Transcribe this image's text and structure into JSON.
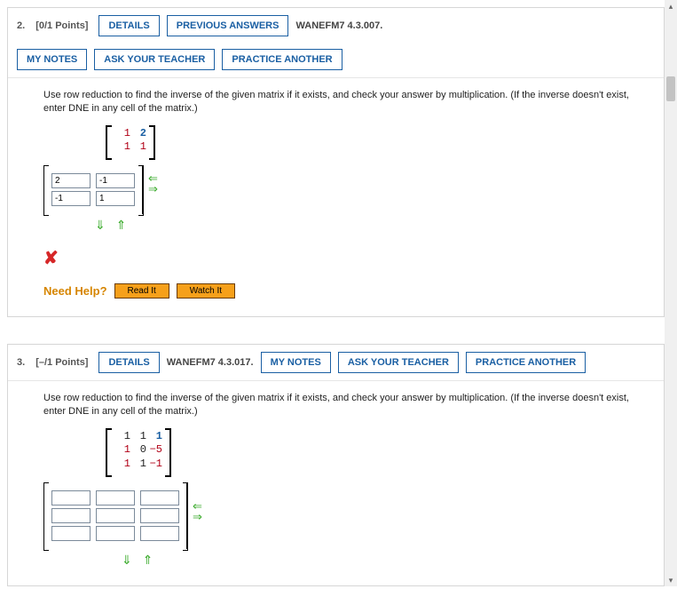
{
  "questions": [
    {
      "number_label": "2.",
      "points": "[0/1 Points]",
      "buttons": {
        "details": "DETAILS",
        "previous": "PREVIOUS ANSWERS",
        "notes": "MY NOTES",
        "ask": "ASK YOUR TEACHER",
        "practice": "PRACTICE ANOTHER"
      },
      "source": "WANEFM7 4.3.007.",
      "instructions": "Use row reduction to find the inverse of the given matrix if it exists, and check your answer by multiplication. (If the inverse doesn't exist, enter DNE in any cell of the matrix.)",
      "given_matrix": [
        [
          "1",
          "2"
        ],
        [
          "1",
          "1"
        ]
      ],
      "answer_matrix": [
        [
          "2",
          "-1"
        ],
        [
          "-1",
          "1"
        ]
      ],
      "wrong": "✘",
      "help_label": "Need Help?",
      "help_read": "Read It",
      "help_watch": "Watch It"
    },
    {
      "number_label": "3.",
      "points": "[–/1 Points]",
      "buttons": {
        "details": "DETAILS",
        "notes": "MY NOTES",
        "ask": "ASK YOUR TEACHER",
        "practice": "PRACTICE ANOTHER"
      },
      "source": "WANEFM7 4.3.017.",
      "instructions": "Use row reduction to find the inverse of the given matrix if it exists, and check your answer by multiplication. (If the inverse doesn't exist, enter DNE in any cell of the matrix.)",
      "given_matrix": [
        [
          "1",
          "1",
          "1"
        ],
        [
          "1",
          "0",
          "−5"
        ],
        [
          "1",
          "1",
          "−1"
        ]
      ],
      "answer_matrix": [
        [
          "",
          "",
          ""
        ],
        [
          "",
          "",
          ""
        ],
        [
          "",
          "",
          ""
        ]
      ]
    }
  ]
}
